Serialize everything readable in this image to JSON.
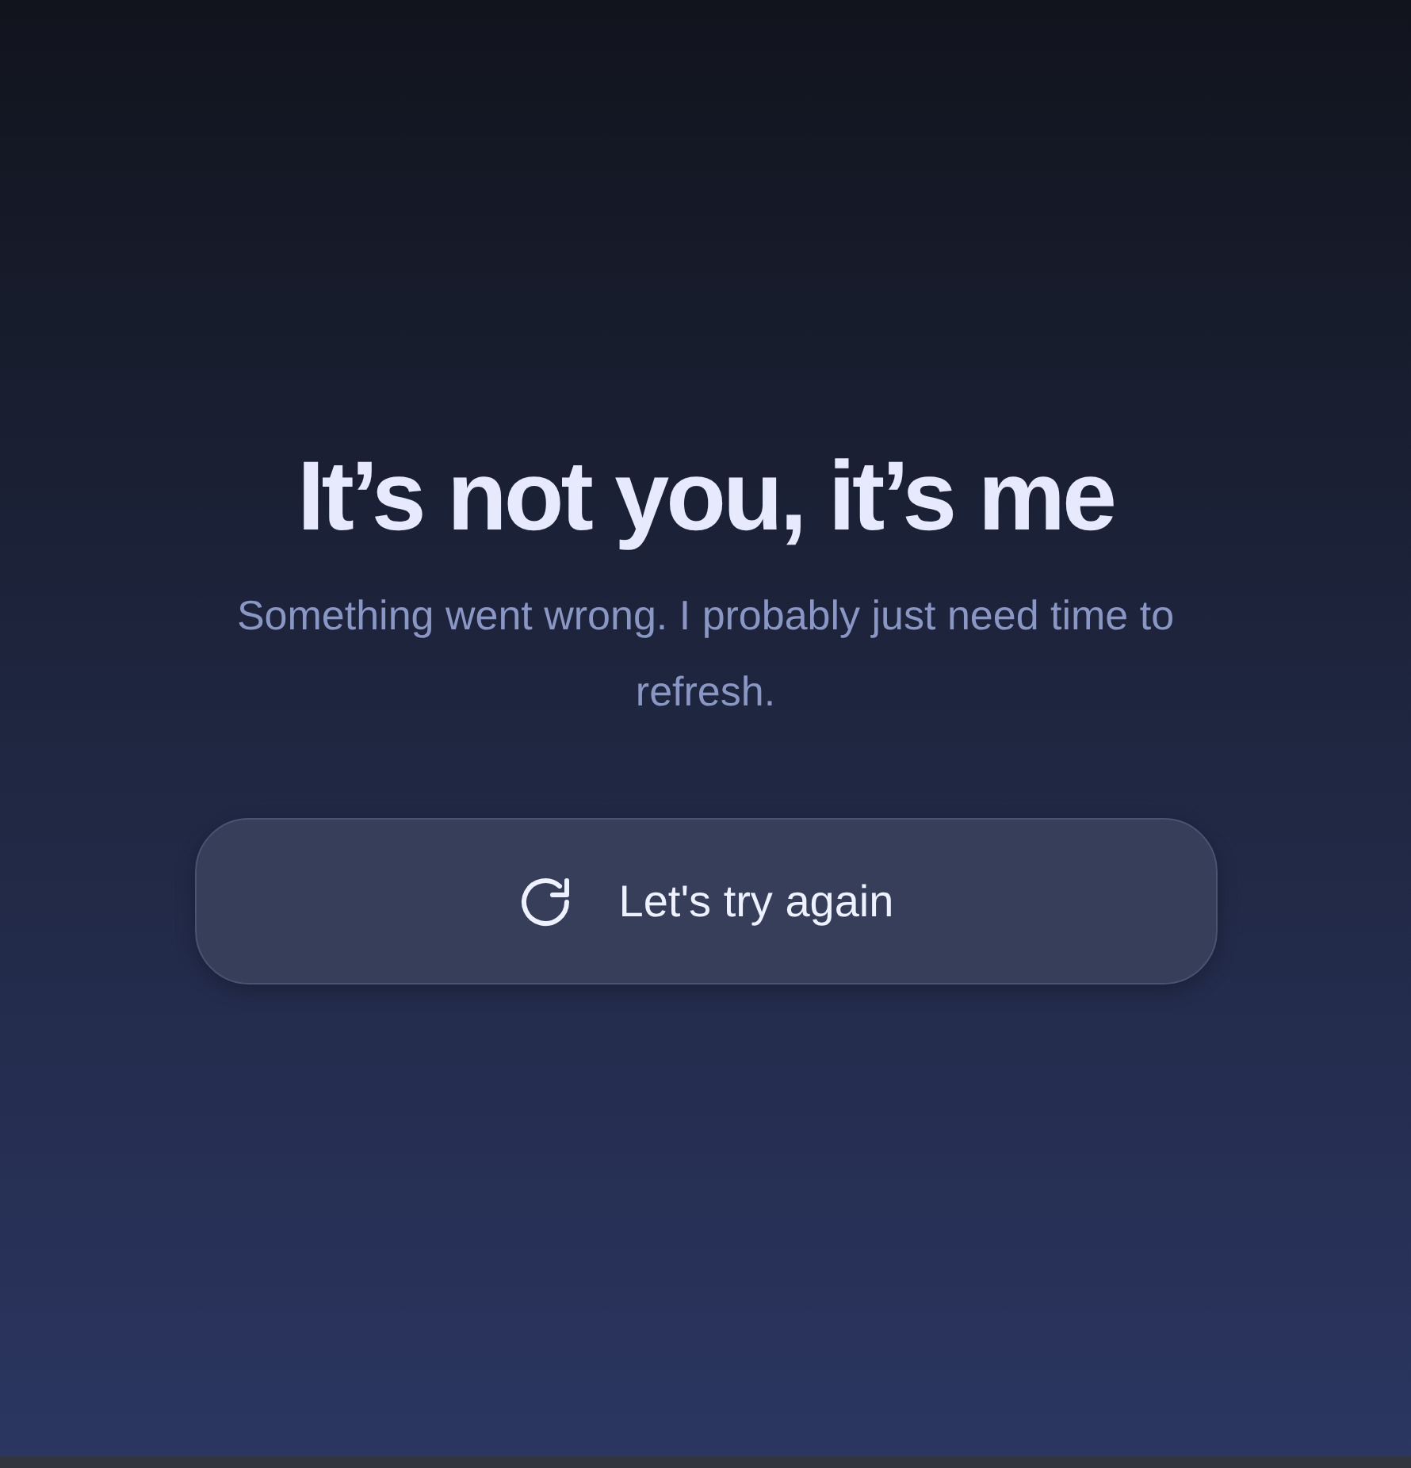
{
  "title": "It’s not you, it’s me",
  "message": "Something went wrong. I probably just need time to refresh.",
  "button": {
    "label": "Let's try again"
  }
}
